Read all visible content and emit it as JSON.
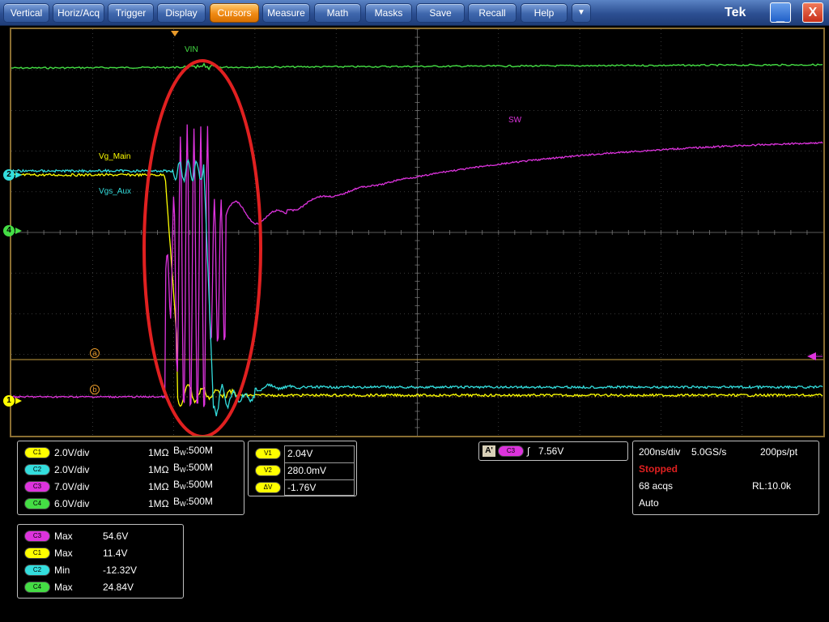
{
  "menu": {
    "items": [
      "Vertical",
      "Horiz/Acq",
      "Trigger",
      "Display",
      "Cursors",
      "Measure",
      "Math",
      "Masks",
      "Save",
      "Recall",
      "Help"
    ],
    "active": "Cursors",
    "more_glyph": "▼",
    "brand": "Tek",
    "minimize_glyph": "_",
    "close_glyph": "X"
  },
  "colors": {
    "ch1": "#ffff00",
    "ch2": "#33dddd",
    "ch3": "#dd33dd",
    "ch4": "#44dd44",
    "annotation": "#e02020",
    "graticule": "#707070",
    "cursor": "#c8a040"
  },
  "screen": {
    "labels": {
      "vin": "VIN",
      "sw": "SW",
      "vg_main": "Vg_Main",
      "vgs_aux": "Vgs_Aux"
    },
    "channel_markers": {
      "ch2": "2",
      "ch4": "4",
      "ch1": "1"
    },
    "cursor_markers": {
      "a": "a",
      "b": "b"
    }
  },
  "channels": [
    {
      "pill": "C1",
      "scale": "2.0V/div",
      "impedance": "1MΩ",
      "bw_b": "B",
      "bw_w": "W",
      "bw_value": ":500M",
      "color": "#ffff00"
    },
    {
      "pill": "C2",
      "scale": "2.0V/div",
      "impedance": "1MΩ",
      "bw_b": "B",
      "bw_w": "W",
      "bw_value": ":500M",
      "color": "#33dddd"
    },
    {
      "pill": "C3",
      "scale": "7.0V/div",
      "impedance": "1MΩ",
      "bw_b": "B",
      "bw_w": "W",
      "bw_value": ":500M",
      "color": "#dd33dd"
    },
    {
      "pill": "C4",
      "scale": "6.0V/div",
      "impedance": "1MΩ",
      "bw_b": "B",
      "bw_w": "W",
      "bw_value": ":500M",
      "color": "#44dd44"
    }
  ],
  "cursor_readout": [
    {
      "label": "V1",
      "value": "2.04V"
    },
    {
      "label": "V2",
      "value": "280.0mV"
    },
    {
      "label": "ΔV",
      "value": "-1.76V"
    }
  ],
  "trigger": {
    "mode_badge": "A'",
    "source": "C3",
    "slope_glyph": "∫",
    "level": "7.56V"
  },
  "acquisition": {
    "timebase": "200ns/div",
    "sample_rate": "5.0GS/s",
    "resolution": "200ps/pt",
    "status": "Stopped",
    "acqs": "68 acqs",
    "record_length": "RL:10.0k",
    "mode": "Auto"
  },
  "measurements": [
    {
      "pill": "C3",
      "type": "Max",
      "value": "54.6V",
      "color": "#dd33dd"
    },
    {
      "pill": "C1",
      "type": "Max",
      "value": "11.4V",
      "color": "#ffff00"
    },
    {
      "pill": "C2",
      "type": "Min",
      "value": "-12.32V",
      "color": "#33dddd"
    },
    {
      "pill": "C4",
      "type": "Max",
      "value": "24.84V",
      "color": "#44dd44"
    }
  ]
}
